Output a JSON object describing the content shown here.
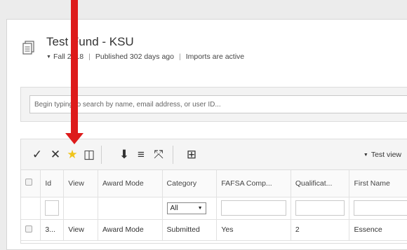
{
  "header": {
    "title": "Test Fund - KSU",
    "term": "Fall 2018",
    "published": "Published 302 days ago",
    "imports": "Imports are active",
    "separator": "|"
  },
  "search": {
    "placeholder": "Begin typing to search by name, email address, or user ID..."
  },
  "toolbar": {
    "check": "✓",
    "close": "✕",
    "star": "★",
    "columns": "◫",
    "download": "⬇",
    "list": "≡",
    "expand": "⤧",
    "grid": "⊞",
    "view_label": "Test view",
    "star_color": "#f0c419"
  },
  "table": {
    "columns": [
      "Id",
      "View",
      "Award Mode",
      "Category",
      "FAFSA Comp...",
      "Qualificat...",
      "First Name"
    ],
    "category_filter": "All",
    "rows": [
      {
        "id": "3...",
        "view": "View",
        "award_mode": "Award Mode",
        "category": "Submitted",
        "fafsa": "Yes",
        "qualification": "2",
        "first_name": "Essence"
      }
    ]
  },
  "annotation": {
    "arrow_color": "#dd1b1b"
  }
}
